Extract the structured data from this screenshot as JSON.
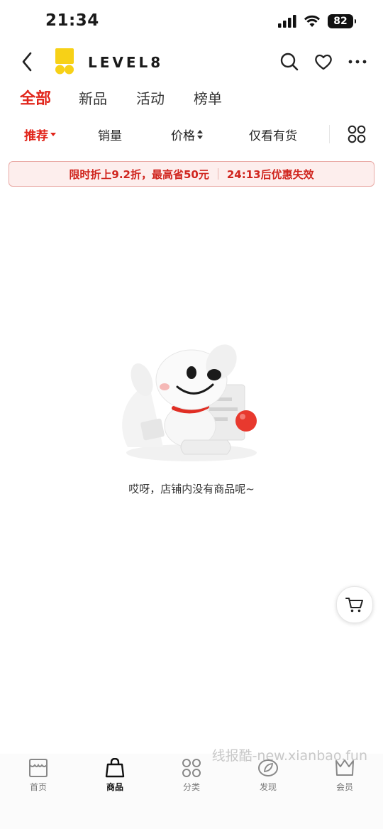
{
  "status_bar": {
    "time": "21:34",
    "battery": "82"
  },
  "header": {
    "brand": "LEVEL8"
  },
  "tabs": [
    {
      "label": "全部",
      "active": true
    },
    {
      "label": "新品"
    },
    {
      "label": "活动"
    },
    {
      "label": "榜单"
    }
  ],
  "sort_bar": {
    "recommend": "推荐",
    "sales": "销量",
    "price": "价格",
    "in_stock": "仅看有货"
  },
  "promo": {
    "text": "限时折上9.2折，最高省50元",
    "countdown": "24:13后优惠失效"
  },
  "empty_state": {
    "message": "哎呀，店铺内没有商品呢~"
  },
  "bottom_nav": [
    {
      "label": "首页"
    },
    {
      "label": "商品",
      "active": true
    },
    {
      "label": "分类"
    },
    {
      "label": "发现"
    },
    {
      "label": "会员"
    }
  ],
  "watermark": "线报酷-new.xianbao.fun",
  "colors": {
    "accent": "#e1251b",
    "promo_bg": "#fdeeed",
    "logo_yellow": "#f7d117"
  }
}
